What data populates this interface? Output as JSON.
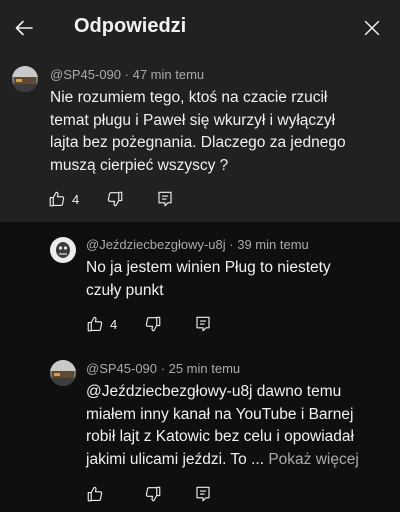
{
  "header": {
    "title": "Odpowiedzi",
    "back_icon": "arrow-left-icon",
    "close_icon": "close-icon"
  },
  "comments": [
    {
      "author": "@SP45-090",
      "time": "47 min temu",
      "text_lines": [
        "Nie rozumiem tego, ktoś na czacie rzucił",
        "temat pługu i Paweł się wkurzył i wyłączył",
        "lajta bez pożegnania. Dlaczego za jednego",
        "muszą cierpieć wszyscy ?"
      ],
      "likes": "4"
    },
    {
      "author": "@Jeździecbezgłowy-u8j",
      "time": "39 min temu",
      "text_lines": [
        "No ja jestem winien Pług to niestety",
        "czuły punkt"
      ],
      "likes": "4"
    },
    {
      "author": "@SP45-090",
      "time": "25 min temu",
      "text_lines": [
        "@Jeździecbezgłowy-u8j dawno temu",
        "miałem inny kanał na YouTube i Barnej",
        "robił lajt z Katowic bez celu i opowiadał",
        "jakimi ulicami jeździ. To ..."
      ],
      "more_label": "Pokaż więcej",
      "likes": ""
    }
  ],
  "colors": {
    "background": "#0f0f0f",
    "header_bg": "#212121",
    "text": "#f1f1f1",
    "muted": "#aaaaaa"
  }
}
